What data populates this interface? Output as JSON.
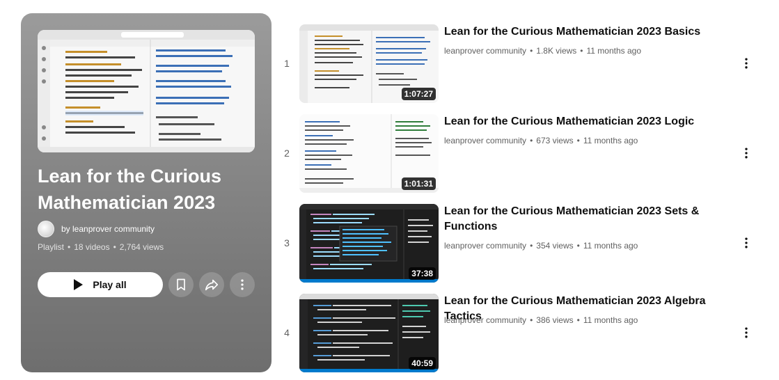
{
  "playlist": {
    "title": "Lean for the Curious Mathematician 2023",
    "owner": "by leanprover community",
    "type": "Playlist",
    "video_count": "18 videos",
    "view_count": "2,764 views",
    "play_all_label": "Play all",
    "icons": [
      "bookmark-icon",
      "share-icon",
      "more-vert-icon"
    ]
  },
  "videos": [
    {
      "index": "1",
      "title": "Lean for the Curious Mathematician 2023 Basics",
      "channel": "leanprover community",
      "views": "1.8K views",
      "age": "11 months ago",
      "duration": "1:07:27"
    },
    {
      "index": "2",
      "title": "Lean for the Curious Mathematician 2023 Logic",
      "channel": "leanprover community",
      "views": "673 views",
      "age": "11 months ago",
      "duration": "1:01:31"
    },
    {
      "index": "3",
      "title": "Lean for the Curious Mathematician 2023 Sets & Functions",
      "channel": "leanprover community",
      "views": "354 views",
      "age": "11 months ago",
      "duration": "37:38"
    },
    {
      "index": "4",
      "title": "Lean for the Curious Mathematician 2023 Algebra Tactics",
      "channel": "leanprover community",
      "views": "386 views",
      "age": "11 months ago",
      "duration": "40:59"
    }
  ],
  "separator": "•",
  "colors": {
    "panel_bg": "#8a8a8a",
    "text_primary": "#0f0f0f",
    "text_secondary": "#606060",
    "dark_editor": "#1e1e1e",
    "light_editor": "#f7f7f7"
  }
}
